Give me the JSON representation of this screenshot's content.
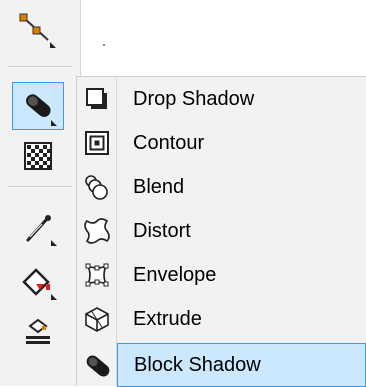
{
  "toolbox": {
    "tools": [
      {
        "icon": "bezier-node-icon"
      },
      {
        "icon": "block-shadow-icon",
        "selected": true
      },
      {
        "icon": "transparency-checker-icon"
      },
      {
        "icon": "eyedropper-icon"
      },
      {
        "icon": "interactive-fill-icon"
      },
      {
        "icon": "smart-fill-icon"
      }
    ]
  },
  "flyout": {
    "items": [
      {
        "icon": "drop-shadow-icon",
        "label": "Drop Shadow"
      },
      {
        "icon": "contour-icon",
        "label": "Contour"
      },
      {
        "icon": "blend-icon",
        "label": "Blend"
      },
      {
        "icon": "distort-icon",
        "label": "Distort"
      },
      {
        "icon": "envelope-icon",
        "label": "Envelope"
      },
      {
        "icon": "extrude-icon",
        "label": "Extrude"
      },
      {
        "icon": "block-shadow-icon",
        "label": "Block Shadow",
        "selected": true
      }
    ]
  },
  "colors": {
    "selection_fill": "#cce8ff",
    "selection_border": "#3d9be9",
    "accent_orange": "#e07b00",
    "accent_red": "#e02020"
  }
}
